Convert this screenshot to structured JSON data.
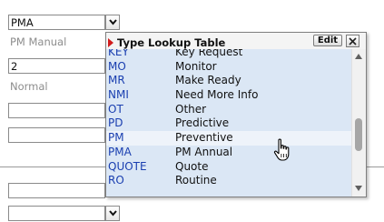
{
  "form": {
    "type_value": "PMA",
    "type_description": "PM Manual",
    "priority_value": "2",
    "priority_description": "Normal"
  },
  "lookup": {
    "title": "Type Lookup Table",
    "edit_label": "Edit",
    "accent_color": "#d11c1c",
    "highlight_color": "#dbe7f5",
    "rows": [
      {
        "code": "KEY",
        "description": "Key Request"
      },
      {
        "code": "MO",
        "description": "Monitor"
      },
      {
        "code": "MR",
        "description": "Make Ready"
      },
      {
        "code": "NMI",
        "description": "Need More Info"
      },
      {
        "code": "OT",
        "description": "Other"
      },
      {
        "code": "PD",
        "description": "Predictive"
      },
      {
        "code": "PM",
        "description": "Preventive"
      },
      {
        "code": "PMA",
        "description": "PM Annual"
      },
      {
        "code": "QUOTE",
        "description": "Quote"
      },
      {
        "code": "RO",
        "description": "Routine"
      }
    ],
    "scroll_position": 0.55
  },
  "icons": {
    "dropdown": "chevron-down-icon",
    "close": "close-icon",
    "marker": "triangle-marker-icon",
    "cursor": "hand-pointer-icon"
  }
}
